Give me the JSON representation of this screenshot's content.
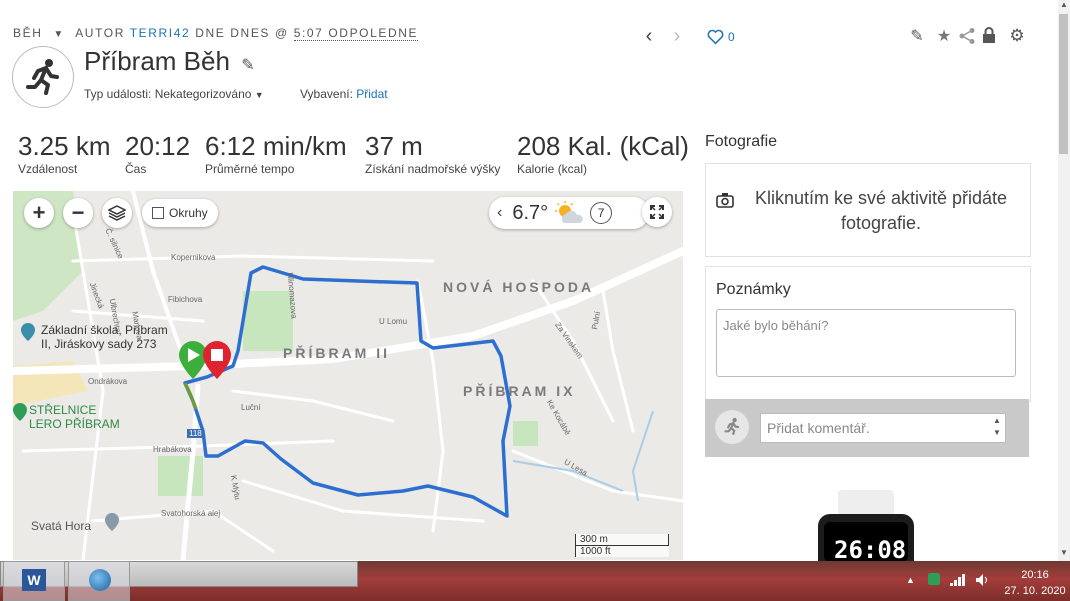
{
  "header": {
    "activity_type": "BĚH",
    "author_prefix": "AUTOR",
    "author": "TERRI42",
    "date_prefix": "DNE DNES @",
    "time": "5:07 ODPOLEDNE",
    "title": "Příbram Běh",
    "likes": "0",
    "event_type_label": "Typ události:",
    "event_type_value": "Nekategorizováno",
    "gear_label": "Vybavení:",
    "gear_value": "Přidat"
  },
  "stats": [
    {
      "value": "3.25 km",
      "label": "Vzdálenost"
    },
    {
      "value": "20:12",
      "label": "Čas"
    },
    {
      "value": "6:12 min/km",
      "label": "Průměrné tempo"
    },
    {
      "value": "37 m",
      "label": "Získání nadmořské výšky"
    },
    {
      "value": "208 Kal. (kCal)",
      "label": "Kalorie (kcal)"
    }
  ],
  "map": {
    "okruhy_label": "Okruhy",
    "temperature": "6.7°",
    "wind": "7",
    "scale_metric": "300 m",
    "scale_imperial": "1000 ft",
    "labels": {
      "nova_hospoda": "NOVÁ HOSPODA",
      "pribram_ii": "PŘÍBRAM II",
      "pribram_ix": "PŘÍBRAM IX",
      "school": "Základní škola, Příbram II, Jiráskovy sady 273",
      "school_1": "Základní škola, Příbram",
      "school_2": "II, Jiráskovy sady 273",
      "strelnice_1": "STŘELNICE",
      "strelnice_2": "LERO PŘÍBRAM",
      "svata_hora": "Svatá Hora",
      "kopernikova": "Kopernikova",
      "jinecka": "Jinecká",
      "mariova": "Mariova",
      "fibichova": "Fibichova",
      "ondrakova": "Ondrákova",
      "lucni": "Luční",
      "hrabakova": "Hrabákova",
      "u_lomu": "U Lomu",
      "za_vinskem": "Za Vinskem",
      "ke_kocabe": "Ke Kocábě",
      "u_lesa": "U Lesa",
      "svatohorska": "Svatohorská alej",
      "k_mytu": "K Mýtu",
      "pulni": "Pulní",
      "hlinomazova": "Hlinomazova",
      "road_number": "118",
      "ulbrechta": "Ulbrechta",
      "c_road": "Č. silnice"
    }
  },
  "photos": {
    "title": "Fotografie",
    "prompt": "Kliknutím ke své aktivitě přidáte fotografie."
  },
  "notes": {
    "title": "Poznámky",
    "placeholder": "Jaké bylo běhání?"
  },
  "comment": {
    "placeholder": "Přidat komentář."
  },
  "device": {
    "display": "26:08"
  },
  "taskbar": {
    "time": "20:16",
    "date": "27. 10. 2020"
  }
}
